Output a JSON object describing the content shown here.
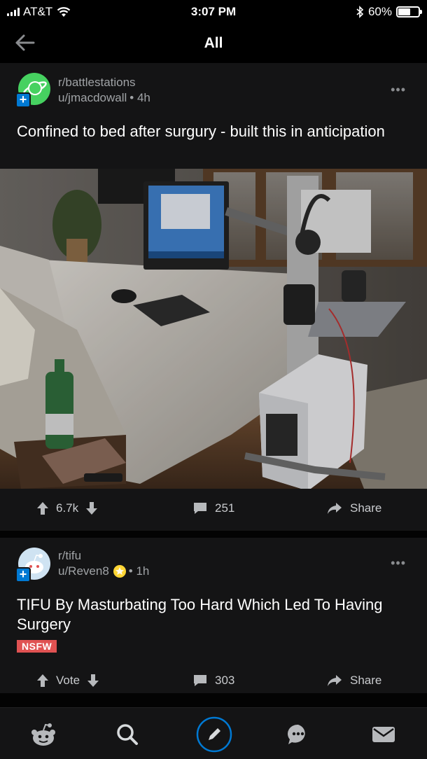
{
  "status_bar": {
    "carrier": "AT&T",
    "time": "3:07 PM",
    "battery": "60%",
    "battery_level": 0.6
  },
  "header": {
    "title": "All"
  },
  "posts": [
    {
      "subreddit": "r/battlestations",
      "user": "u/jmacdowall",
      "age": "• 4h",
      "title": "Confined to bed after surgury - built this in anticipation",
      "upvotes": "6.7k",
      "comments": "251",
      "share": "Share",
      "avatar_color": "#46d160"
    },
    {
      "subreddit": "r/tifu",
      "user": "u/Reven8",
      "age": "• 1h",
      "title": "TIFU By Masturbating Too Hard Which Led To Having Surgery",
      "flair": "NSFW",
      "upvotes": "Vote",
      "comments": "303",
      "share": "Share",
      "avatar_color": "#cfe3f2"
    }
  ],
  "more_label": "•••",
  "tabs": [
    "home-icon",
    "search-icon",
    "compose-icon",
    "chat-icon",
    "inbox-icon"
  ],
  "colors": {
    "accent": "#0079d3",
    "nsfw": "#e05252",
    "compose_ring": "#0079d3"
  }
}
